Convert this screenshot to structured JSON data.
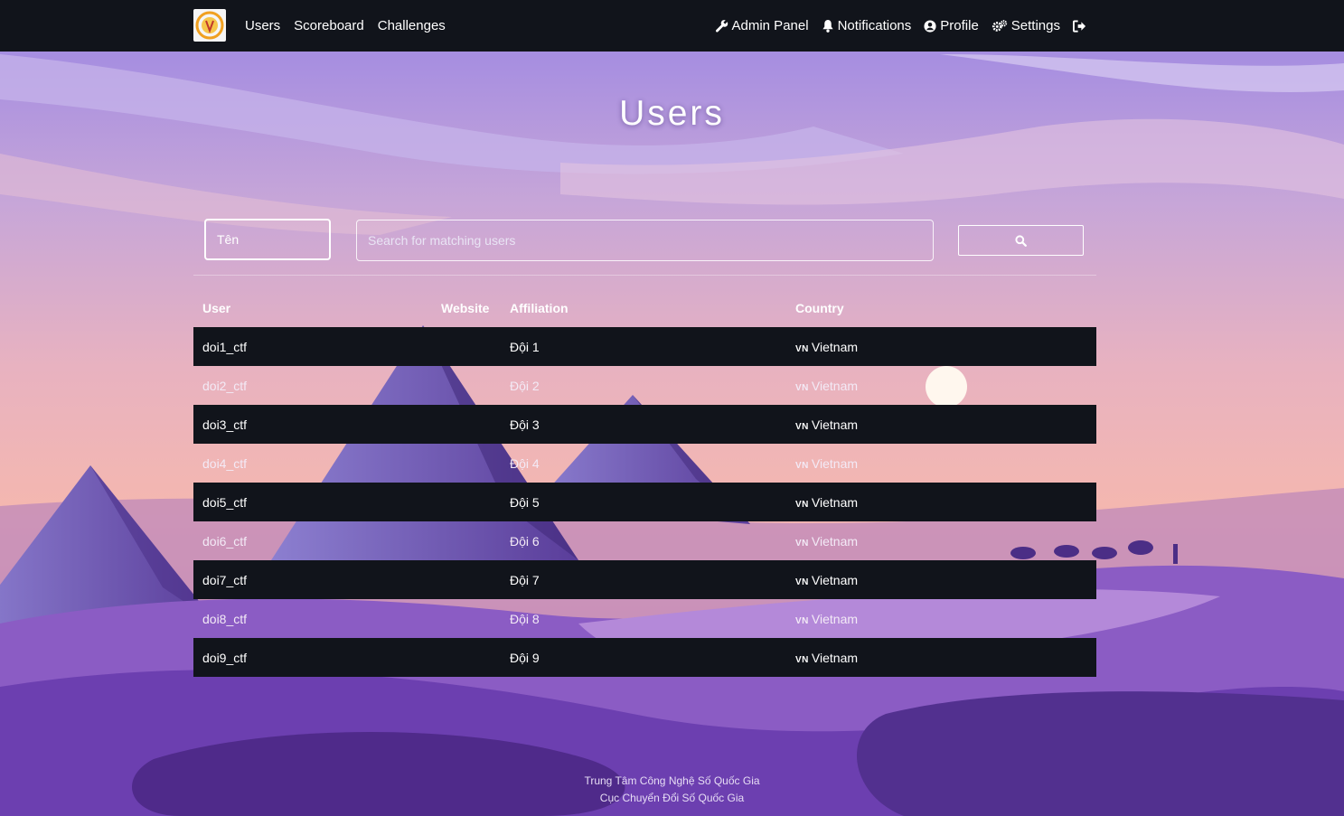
{
  "nav": {
    "logo_icon": "shield-logo-icon",
    "left_links": [
      {
        "label": "Users"
      },
      {
        "label": "Scoreboard"
      },
      {
        "label": "Challenges"
      }
    ],
    "right_links": [
      {
        "label": "Admin Panel",
        "icon": "wrench-icon"
      },
      {
        "label": "Notifications",
        "icon": "bell-icon"
      },
      {
        "label": "Profile",
        "icon": "user-circle-icon"
      },
      {
        "label": "Settings",
        "icon": "gears-icon"
      }
    ],
    "logout_icon": "logout-icon"
  },
  "page": {
    "title": "Users"
  },
  "search": {
    "field_value": "Tên",
    "placeholder": "Search for matching users",
    "button_icon": "search-icon"
  },
  "table": {
    "headers": {
      "user": "User",
      "website": "Website",
      "affiliation": "Affiliation",
      "country": "Country"
    },
    "rows": [
      {
        "user": "doi1_ctf",
        "website": "",
        "affiliation": "Đội 1",
        "flag": "VN",
        "country": "Vietnam"
      },
      {
        "user": "doi2_ctf",
        "website": "",
        "affiliation": "Đội 2",
        "flag": "VN",
        "country": "Vietnam"
      },
      {
        "user": "doi3_ctf",
        "website": "",
        "affiliation": "Đội 3",
        "flag": "VN",
        "country": "Vietnam"
      },
      {
        "user": "doi4_ctf",
        "website": "",
        "affiliation": "Đội 4",
        "flag": "VN",
        "country": "Vietnam"
      },
      {
        "user": "doi5_ctf",
        "website": "",
        "affiliation": "Đội 5",
        "flag": "VN",
        "country": "Vietnam"
      },
      {
        "user": "doi6_ctf",
        "website": "",
        "affiliation": "Đội 6",
        "flag": "VN",
        "country": "Vietnam"
      },
      {
        "user": "doi7_ctf",
        "website": "",
        "affiliation": "Đội 7",
        "flag": "VN",
        "country": "Vietnam"
      },
      {
        "user": "doi8_ctf",
        "website": "",
        "affiliation": "Đội 8",
        "flag": "VN",
        "country": "Vietnam"
      },
      {
        "user": "doi9_ctf",
        "website": "",
        "affiliation": "Đội 9",
        "flag": "VN",
        "country": "Vietnam"
      }
    ]
  },
  "footer": {
    "line1": "Trung Tâm Công Nghệ Số Quốc Gia",
    "line2": "Cục Chuyển Đổi Số Quốc Gia"
  },
  "colors": {
    "navbar": "#11141b",
    "dark_row": "#11141b",
    "sky_top": "#9d86e0",
    "sky_bottom": "#f2b6b4",
    "dune": "#6a3fb0"
  }
}
